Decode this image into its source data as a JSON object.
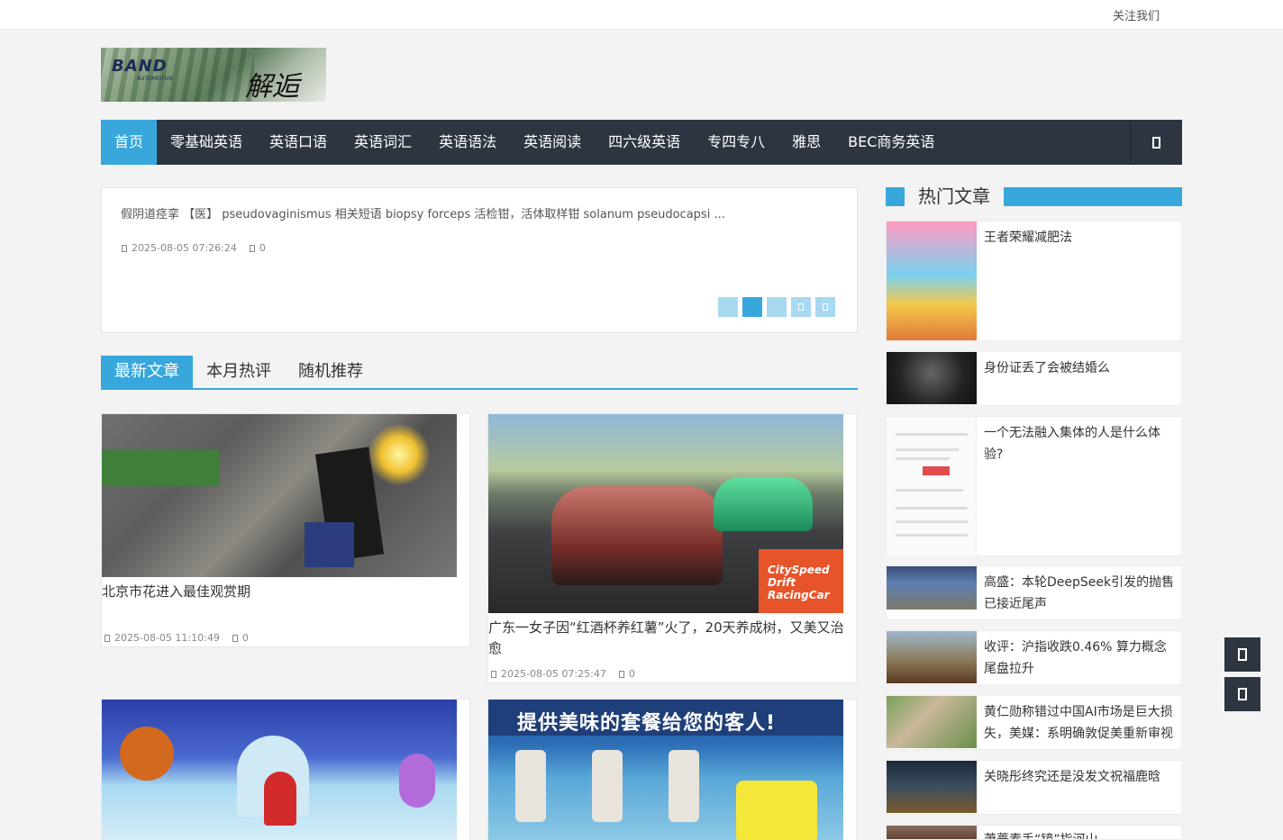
{
  "topbar": {
    "follow_label": "关注我们"
  },
  "logo": {
    "brand": "BAND",
    "brand_sub": "AUTOMOTIVE",
    "signature": "解逅"
  },
  "nav": {
    "items": [
      "首页",
      "零基础英语",
      "英语口语",
      "英语词汇",
      "英语语法",
      "英语阅读",
      "四六级英语",
      "专四专八",
      "雅思",
      "BEC商务英语"
    ],
    "active_index": 0,
    "search_icon": "search-icon"
  },
  "slider": {
    "text": "假阴道痉挛 【医】 pseudovaginismus 相关短语 biopsy forceps 活检钳，活体取样钳 solanum pseudocapsi ...",
    "date": "2025-08-05 07:26:24",
    "comments": "0",
    "dots_active_index": 1
  },
  "tabs": {
    "items": [
      "最新文章",
      "本月热评",
      "随机推荐"
    ],
    "active_index": 0
  },
  "articles": [
    {
      "title": "北京市花进入最佳观赏期",
      "date": "2025-08-05 11:10:49",
      "comments": "0"
    },
    {
      "title": "广东一女子因“红酒杯养红薯”火了，20天养成树，又美又治愈",
      "date": "2025-08-05 07:25:47",
      "comments": "0"
    },
    {
      "title": "",
      "date": "",
      "comments": ""
    },
    {
      "title": "",
      "date": "",
      "comments": "",
      "banner_text": "提供美味的套餐给您的客人!"
    }
  ],
  "game_logo": {
    "line1": "City",
    "line1b": "Speed",
    "line2": "Drift",
    "line3": "RacingCar"
  },
  "sidebar": {
    "title": "热门文章",
    "items": [
      {
        "title": "王者荣耀减肥法"
      },
      {
        "title": "身份证丢了会被结婚么"
      },
      {
        "title": "一个无法融入集体的人是什么体验?"
      },
      {
        "title": "高盛：本轮DeepSeek引发的抛售已接近尾声"
      },
      {
        "title": "收评：沪指收跌0.46% 算力概念尾盘拉升"
      },
      {
        "title": "黄仁勋称错过中国AI市场是巨大损失，美媒：系明确敦促美重新审视"
      },
      {
        "title": "关晓彤终究还是没发文祝福鹿晗"
      },
      {
        "title": "萧蔷素手“镜”指河山"
      }
    ]
  },
  "floating": {
    "top_icon": "back-to-top-icon",
    "bottom_icon": "qr-icon"
  },
  "colors": {
    "accent": "#37a7dc",
    "nav_bg": "#2d3640",
    "page_bg": "#f3f3f3"
  }
}
